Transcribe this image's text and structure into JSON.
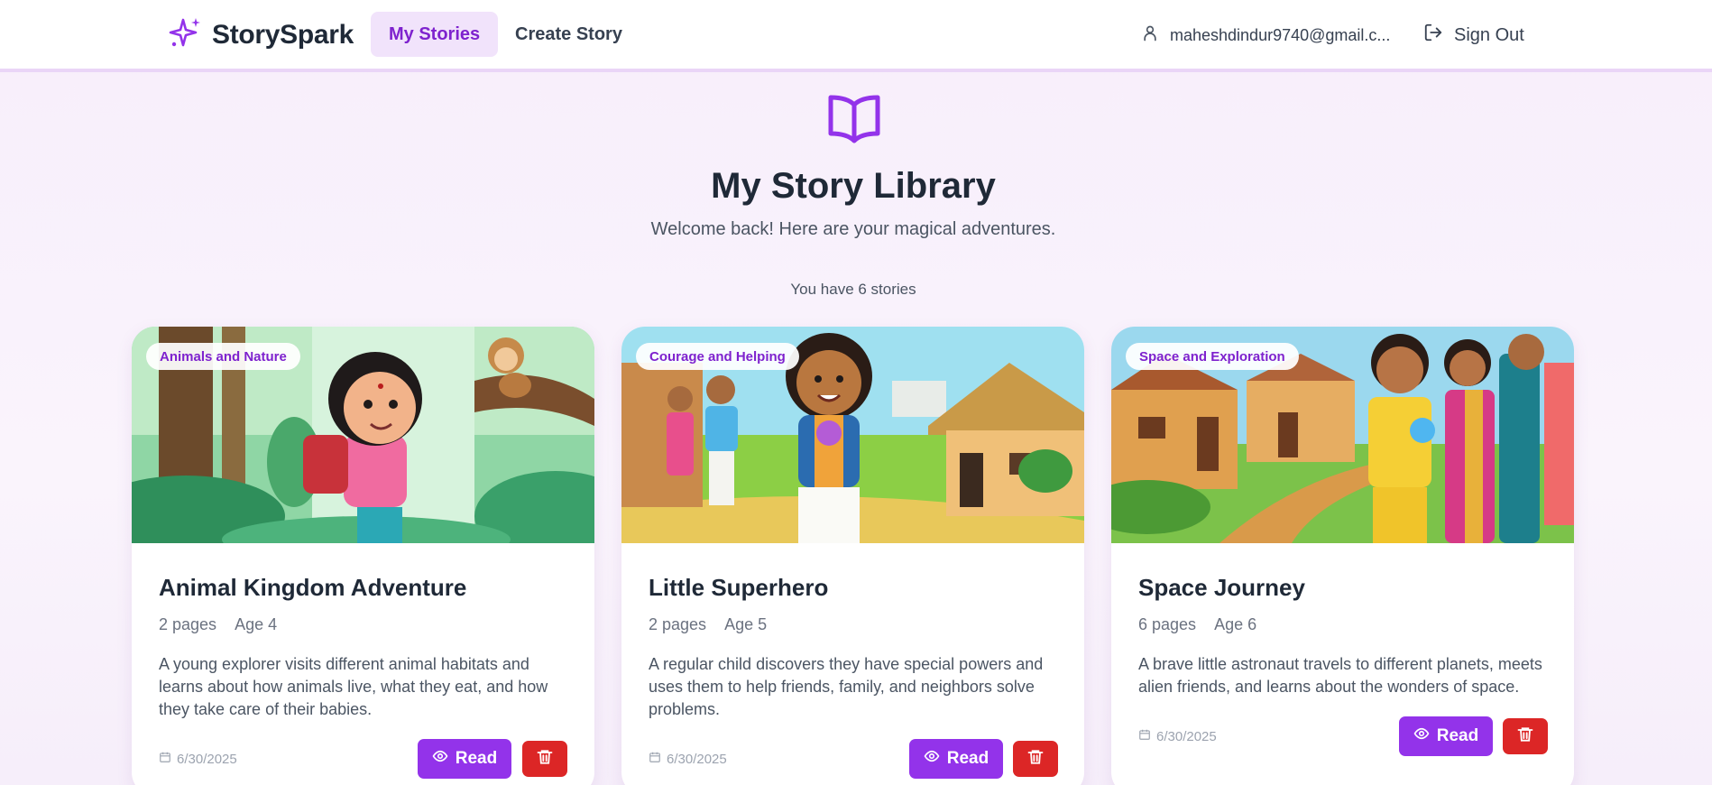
{
  "app": {
    "name": "StorySpark"
  },
  "nav": {
    "items": [
      {
        "label": "My Stories",
        "active": true
      },
      {
        "label": "Create Story",
        "active": false
      }
    ]
  },
  "user": {
    "email": "maheshdindur9740@gmail.c..."
  },
  "signout": {
    "label": "Sign Out"
  },
  "hero": {
    "title": "My Story Library",
    "subtitle": "Welcome back! Here are your magical adventures.",
    "count": "You have 6 stories"
  },
  "colors": {
    "accent": "#9333ea",
    "accent_light": "#f1e3fb",
    "danger": "#dc2626"
  },
  "icons": {
    "logo": "sparkles-icon",
    "user": "user-icon",
    "signout": "log-out-icon",
    "hero": "book-open-icon",
    "date": "calendar-icon",
    "read": "eye-icon",
    "delete": "trash-icon"
  },
  "stories": [
    {
      "category": "Animals and Nature",
      "title": "Animal Kingdom Adventure",
      "pages": "2 pages",
      "age": "Age 4",
      "description": "A young explorer visits different animal habitats and learns about how animals live, what they eat, and how they take care of their babies.",
      "date": "6/30/2025",
      "read_label": "Read",
      "illustration": "girl with backpack in jungle with monkey"
    },
    {
      "category": "Courage and Helping",
      "title": "Little Superhero",
      "pages": "2 pages",
      "age": "Age 5",
      "description": "A regular child discovers they have special powers and uses them to help friends, family, and neighbors solve problems.",
      "date": "6/30/2025",
      "read_label": "Read",
      "illustration": "boy holding glowing flower in village"
    },
    {
      "category": "Space and Exploration",
      "title": "Space Journey",
      "pages": "6 pages",
      "age": "Age 6",
      "description": "A brave little astronaut travels to different planets, meets alien friends, and learns about the wonders of space.",
      "date": "6/30/2025",
      "read_label": "Read",
      "illustration": "boy holding glowing crystal with family in village"
    }
  ]
}
